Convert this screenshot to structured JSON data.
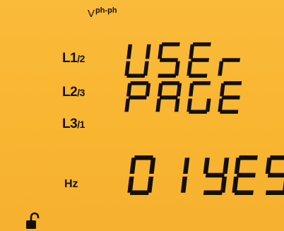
{
  "unit_label": "V",
  "unit_super": "ph-ph",
  "phase_labels": [
    {
      "main": "L1",
      "sub": "/2"
    },
    {
      "main": "L2",
      "sub": "/3"
    },
    {
      "main": "L3",
      "sub": "/1"
    }
  ],
  "frequency_label": "Hz",
  "display": {
    "line1": "USEr",
    "line2": "PAGE",
    "line3_left": "01",
    "line3_right": "YES"
  },
  "status_icon": "unlocked-padlock-icon",
  "colors": {
    "background": "#F9B633",
    "segment": "#141008"
  }
}
